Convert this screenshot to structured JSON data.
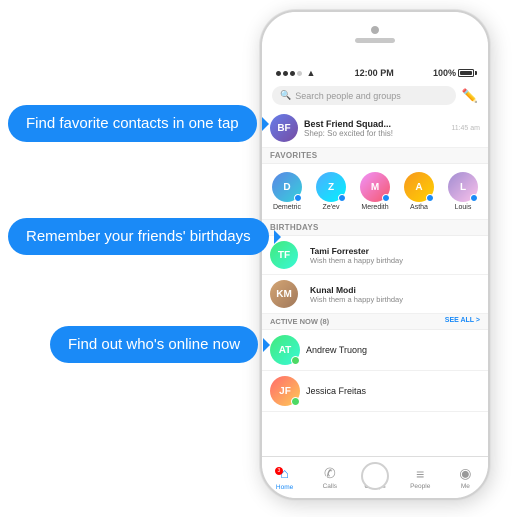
{
  "callouts": [
    {
      "id": "callout1",
      "text": "Find favorite contacts in one tap"
    },
    {
      "id": "callout2",
      "text": "Remember your friends' birthdays"
    },
    {
      "id": "callout3",
      "text": "Find out who's online now"
    }
  ],
  "status_bar": {
    "signal_dots": 3,
    "wifi": "▲",
    "time": "12:00 PM",
    "battery_pct": "100%"
  },
  "search": {
    "placeholder": "Search people and groups"
  },
  "recent_chat": {
    "name": "Best Friend Squad...",
    "preview": "Shep: So excited for this!",
    "time": "11:45 am"
  },
  "sections": {
    "favorites_label": "FAVORITES",
    "birthdays_label": "BIRTHDAYS",
    "active_now_label": "ACTIVE NOW (8)",
    "see_all": "SEE ALL >"
  },
  "favorites": [
    {
      "name": "Demetric",
      "color": "av-blue"
    },
    {
      "name": "Ze'ev",
      "color": "av-green"
    },
    {
      "name": "Meredith",
      "color": "av-pink"
    },
    {
      "name": "Astha",
      "color": "av-orange"
    },
    {
      "name": "Louis",
      "color": "av-purple"
    }
  ],
  "birthdays": [
    {
      "name": "Tami Forrester",
      "action": "Wish them a happy birthday"
    },
    {
      "name": "Kunal Modi",
      "action": "Wish them a happy birthday"
    }
  ],
  "active_people": [
    {
      "name": "Andrew Truong",
      "color": "av-teal"
    },
    {
      "name": "Jessica Freitas",
      "color": "av-red"
    }
  ],
  "nav": [
    {
      "id": "home",
      "icon": "⌂",
      "label": "Home",
      "active": true,
      "badge": true
    },
    {
      "id": "calls",
      "icon": "✆",
      "label": "Calls",
      "active": false
    },
    {
      "id": "groups",
      "icon": "⊞",
      "label": "Groups",
      "active": false
    },
    {
      "id": "people",
      "icon": "≡",
      "label": "People",
      "active": false
    },
    {
      "id": "me",
      "icon": "◉",
      "label": "Me",
      "active": false
    }
  ]
}
